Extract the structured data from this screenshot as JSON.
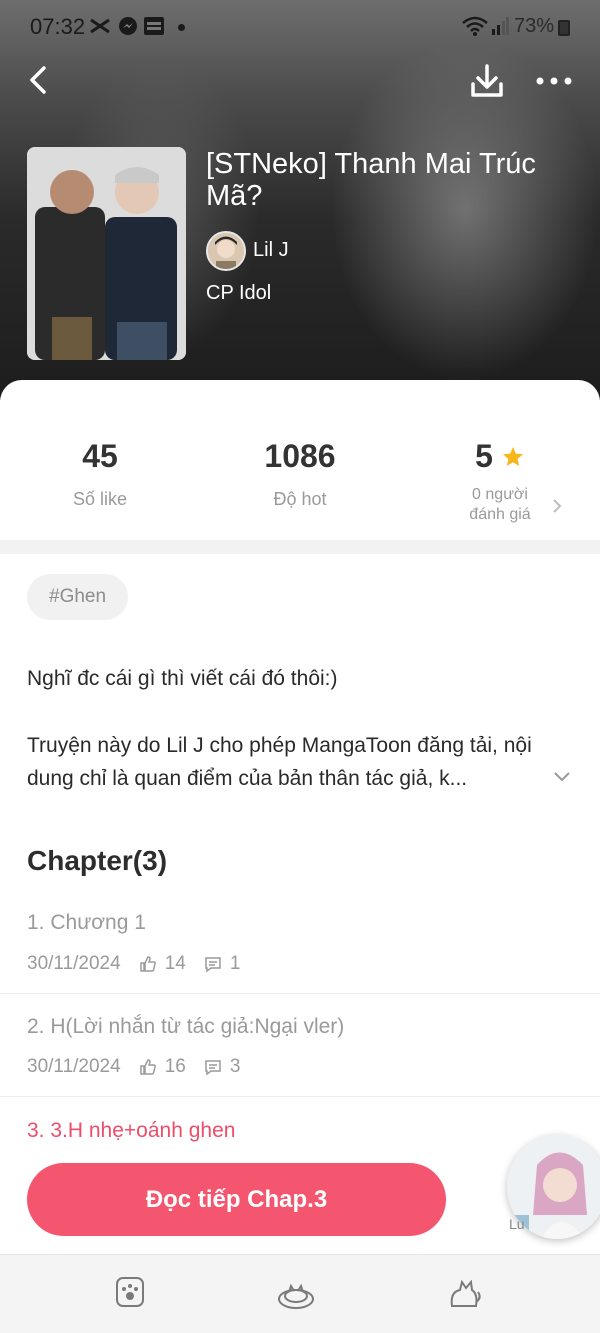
{
  "status_bar": {
    "time": "07:32",
    "battery": "73%",
    "notification_icons": [
      "capcut-icon",
      "messenger-icon",
      "play-games-icon"
    ],
    "status_icons": [
      "wifi-icon",
      "signal-icon",
      "battery-icon"
    ]
  },
  "header": {
    "back_icon": "chevron-left-icon",
    "download_icon": "download-icon",
    "more_icon": "more-horizontal-icon"
  },
  "book": {
    "title": "[STNeko] Thanh Mai Trúc Mã?",
    "author": "Lil J",
    "category": "CP Idol"
  },
  "stats": {
    "likes": {
      "value": "45",
      "label": "Số like"
    },
    "hot": {
      "value": "1086",
      "label": "Độ hot"
    },
    "rating": {
      "value": "5",
      "label_line1": "0 người",
      "label_line2": "đánh giá"
    }
  },
  "tags": [
    "#Ghen"
  ],
  "description": {
    "p1": "Nghĩ đc cái gì thì viết cái đó thôi:)",
    "p2": "Truyện này do Lil J cho phép MangaToon đăng tải, nội dung chỉ là quan điểm của bản thân tác giả, k..."
  },
  "chapters": {
    "header": "Chapter(3)",
    "items": [
      {
        "name": "1. Chương 1",
        "date": "30/11/2024",
        "likes": "14",
        "comments": "1"
      },
      {
        "name": "2. H(Lời nhắn từ tác giả:Ngại vler)",
        "date": "30/11/2024",
        "likes": "16",
        "comments": "3"
      },
      {
        "name": "3. 3.H nhẹ+oánh ghen"
      }
    ]
  },
  "actions": {
    "continue_label": "Đọc tiếp Chap.3",
    "float_label": "Lu"
  },
  "tabbar": {
    "icons": [
      "paw-icon",
      "cat-bed-icon",
      "cat-icon"
    ]
  },
  "colors": {
    "accent": "#f5566f",
    "active_chapter": "#ee4d6a",
    "star": "#f6b71a"
  }
}
